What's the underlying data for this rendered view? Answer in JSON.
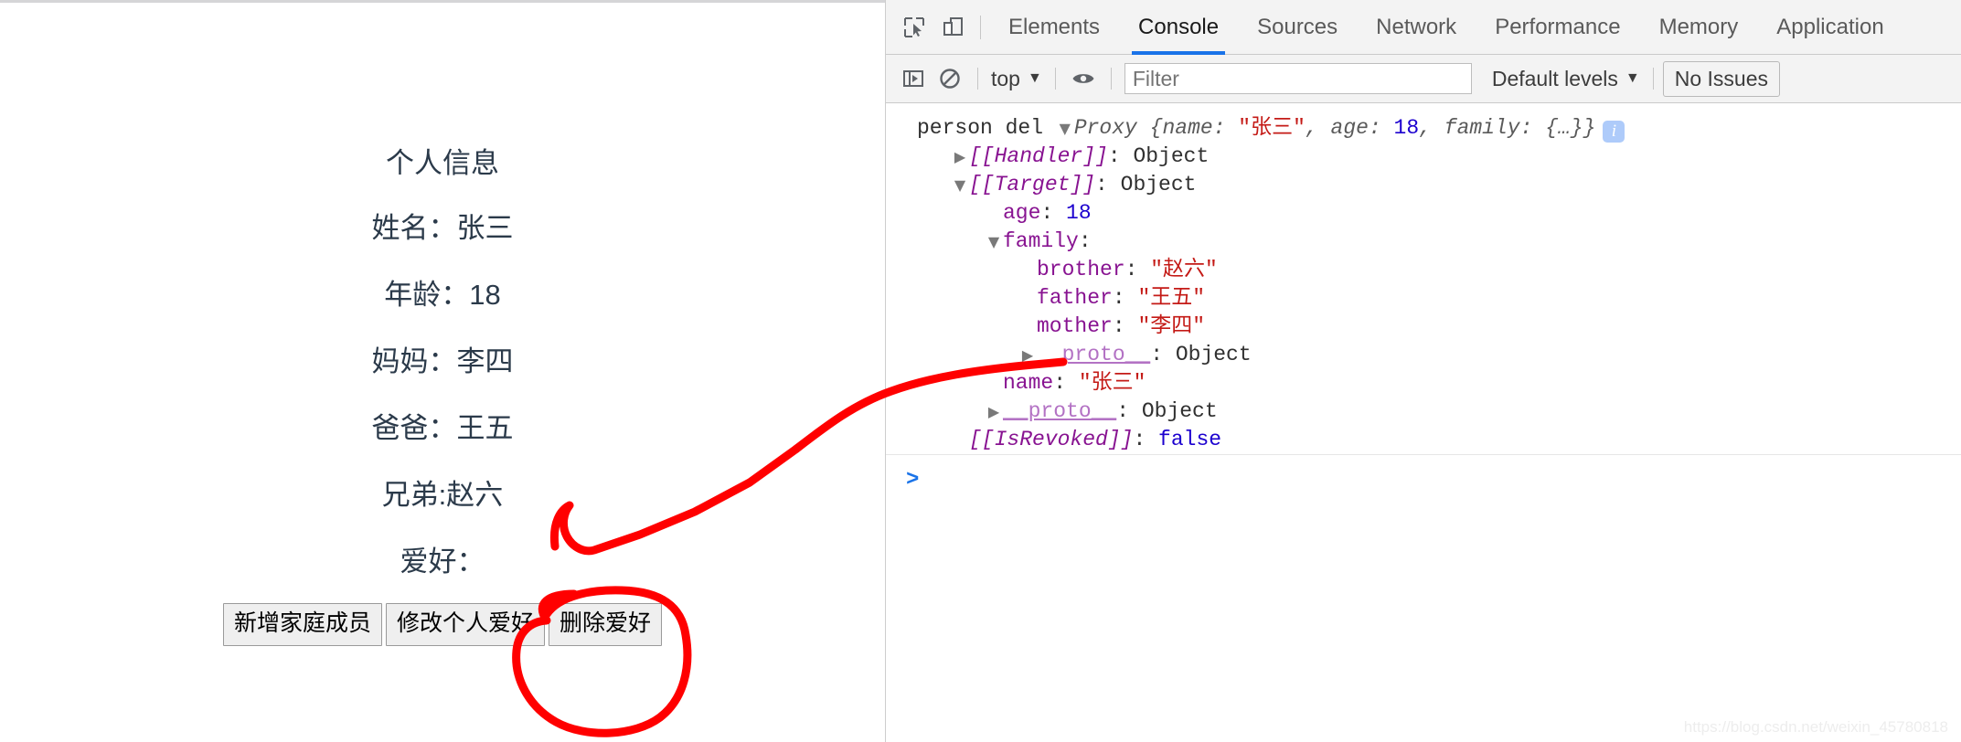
{
  "page": {
    "title": "个人信息",
    "fields": [
      "姓名：张三",
      "年龄：18",
      "妈妈：李四",
      "爸爸：王五",
      "兄弟:赵六",
      "爱好："
    ],
    "buttons": [
      {
        "label": "新增家庭成员",
        "name": "add-family-member-button"
      },
      {
        "label": "修改个人爱好",
        "name": "edit-hobby-button"
      },
      {
        "label": "删除爱好",
        "name": "delete-hobby-button"
      }
    ]
  },
  "devtools": {
    "icons": {
      "inspect": "inspect-element-icon",
      "device": "device-toolbar-icon",
      "execute": "execute-sidebar-icon",
      "clear": "clear-console-icon",
      "eye": "eye-icon"
    },
    "tabs": [
      {
        "label": "Elements",
        "active": false
      },
      {
        "label": "Console",
        "active": true
      },
      {
        "label": "Sources",
        "active": false
      },
      {
        "label": "Network",
        "active": false
      },
      {
        "label": "Performance",
        "active": false
      },
      {
        "label": "Memory",
        "active": false
      },
      {
        "label": "Application",
        "active": false
      }
    ],
    "filterbar": {
      "context": "top",
      "caret": "▼",
      "filter_placeholder": "Filter",
      "filter_value": "",
      "levels": "Default levels",
      "issues": "No Issues"
    },
    "console": {
      "prompt": ">",
      "lines": [
        {
          "indent": 0,
          "triangle": "",
          "parts": [
            {
              "t": "person del ",
              "c": "lbl"
            },
            {
              "t": "▼",
              "c": "tri-inline"
            },
            {
              "t": "Proxy ",
              "c": "proxy"
            },
            {
              "t": "{",
              "c": "proxy"
            },
            {
              "t": "name",
              "c": "proxy"
            },
            {
              "t": ": ",
              "c": "proxy"
            },
            {
              "t": "\"张三\"",
              "c": "str"
            },
            {
              "t": ", ",
              "c": "proxy"
            },
            {
              "t": "age",
              "c": "proxy"
            },
            {
              "t": ": ",
              "c": "proxy"
            },
            {
              "t": "18",
              "c": "num"
            },
            {
              "t": ", ",
              "c": "proxy"
            },
            {
              "t": "family",
              "c": "proxy"
            },
            {
              "t": ": {…}}",
              "c": "proxy"
            }
          ],
          "badge": "i"
        },
        {
          "indent": 1,
          "triangle": "▶",
          "parts": [
            {
              "t": "[[Handler]]",
              "c": "internal"
            },
            {
              "t": ": ",
              "c": "plain"
            },
            {
              "t": "Object",
              "c": "plain"
            }
          ]
        },
        {
          "indent": 1,
          "triangle": "▼",
          "parts": [
            {
              "t": "[[Target]]",
              "c": "internal"
            },
            {
              "t": ": ",
              "c": "plain"
            },
            {
              "t": "Object",
              "c": "plain"
            }
          ]
        },
        {
          "indent": 2,
          "triangle": "",
          "parts": [
            {
              "t": "age",
              "c": "prop"
            },
            {
              "t": ": ",
              "c": "plain"
            },
            {
              "t": "18",
              "c": "num"
            }
          ]
        },
        {
          "indent": 2,
          "triangle": "▼",
          "parts": [
            {
              "t": "family",
              "c": "prop"
            },
            {
              "t": ":",
              "c": "plain"
            }
          ]
        },
        {
          "indent": 3,
          "triangle": "",
          "parts": [
            {
              "t": "brother",
              "c": "prop"
            },
            {
              "t": ": ",
              "c": "plain"
            },
            {
              "t": "\"赵六\"",
              "c": "str"
            }
          ]
        },
        {
          "indent": 3,
          "triangle": "",
          "parts": [
            {
              "t": "father",
              "c": "prop"
            },
            {
              "t": ": ",
              "c": "plain"
            },
            {
              "t": "\"王五\"",
              "c": "str"
            }
          ]
        },
        {
          "indent": 3,
          "triangle": "",
          "parts": [
            {
              "t": "mother",
              "c": "prop"
            },
            {
              "t": ": ",
              "c": "plain"
            },
            {
              "t": "\"李四\"",
              "c": "str"
            }
          ]
        },
        {
          "indent": 3,
          "triangle": "▶",
          "parts": [
            {
              "t": "__proto__",
              "c": "proto"
            },
            {
              "t": ": ",
              "c": "plain"
            },
            {
              "t": "Object",
              "c": "plain"
            }
          ]
        },
        {
          "indent": 2,
          "triangle": "",
          "parts": [
            {
              "t": "name",
              "c": "prop"
            },
            {
              "t": ": ",
              "c": "plain"
            },
            {
              "t": "\"张三\"",
              "c": "str"
            }
          ]
        },
        {
          "indent": 2,
          "triangle": "▶",
          "parts": [
            {
              "t": "__proto__",
              "c": "proto"
            },
            {
              "t": ": ",
              "c": "plain"
            },
            {
              "t": "Object",
              "c": "plain"
            }
          ]
        },
        {
          "indent": 1,
          "triangle": "",
          "parts": [
            {
              "t": "[[IsRevoked]]",
              "c": "internal"
            },
            {
              "t": ": ",
              "c": "plain"
            },
            {
              "t": "false",
              "c": "bool"
            }
          ]
        }
      ]
    },
    "watermark": "https://blog.csdn.net/weixin_45780818"
  },
  "annotations": {
    "arrow_color": "#ff0000",
    "circle_color": "#ff0000"
  }
}
